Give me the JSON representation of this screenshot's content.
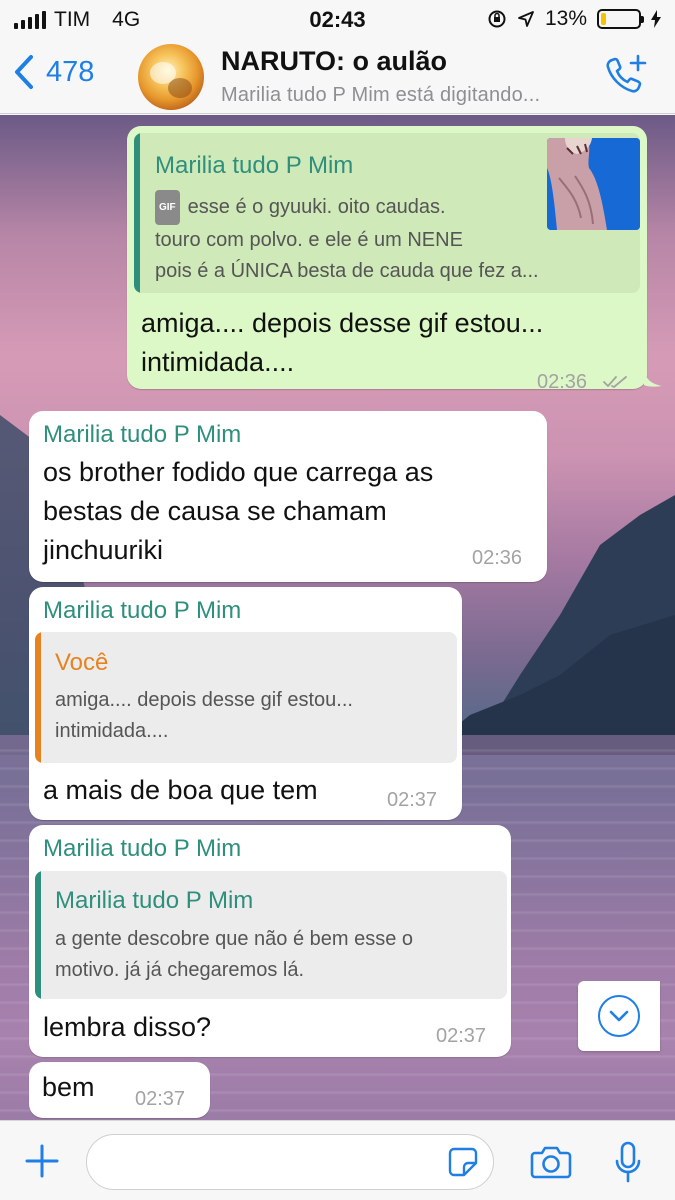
{
  "status_bar": {
    "carrier": "TIM",
    "network": "4G",
    "time": "02:43",
    "battery_percent": "13%",
    "battery_level": 0.13
  },
  "header": {
    "back_count": "478",
    "title": "NARUTO: o aulão",
    "subtitle": "Marilia tudo P Mim  está digitando..."
  },
  "messages": {
    "m1": {
      "quote_name": "Marilia tudo P Mim",
      "quote_badge": "GIF",
      "quote_line1": "esse é o gyuuki. oito caudas.",
      "quote_line2": "touro com polvo. e ele é um NENE",
      "quote_line3": "pois é a ÚNICA besta de cauda que fez a...",
      "line1": "amiga.... depois desse gif estou...",
      "line2": "intimidada....",
      "time": "02:36"
    },
    "m2": {
      "sender": "Marilia tudo P Mim",
      "line1": "os brother fodido que carrega as",
      "line2": "bestas de causa se chamam",
      "line3": "jinchuuriki",
      "time": "02:36"
    },
    "m3": {
      "sender": "Marilia tudo P Mim",
      "quote_name": "Você",
      "quote_line1": "amiga.... depois desse gif estou...",
      "quote_line2": "intimidada....",
      "text": "a mais de boa que tem",
      "time": "02:37"
    },
    "m4": {
      "sender": "Marilia tudo P Mim",
      "quote_name": "Marilia tudo P Mim",
      "quote_line1": "a gente descobre que não é bem esse o",
      "quote_line2": "motivo. já já chegaremos lá.",
      "text": "lembra disso?",
      "time": "02:37"
    },
    "m5": {
      "text": "bem",
      "time": "02:37"
    }
  },
  "colors": {
    "accent_blue": "#1f7fe5",
    "sender_green": "#2f8f7d",
    "you_orange": "#e8821e",
    "outgoing_bubble": "#dcf8c6"
  },
  "input": {
    "placeholder": "",
    "value": ""
  }
}
